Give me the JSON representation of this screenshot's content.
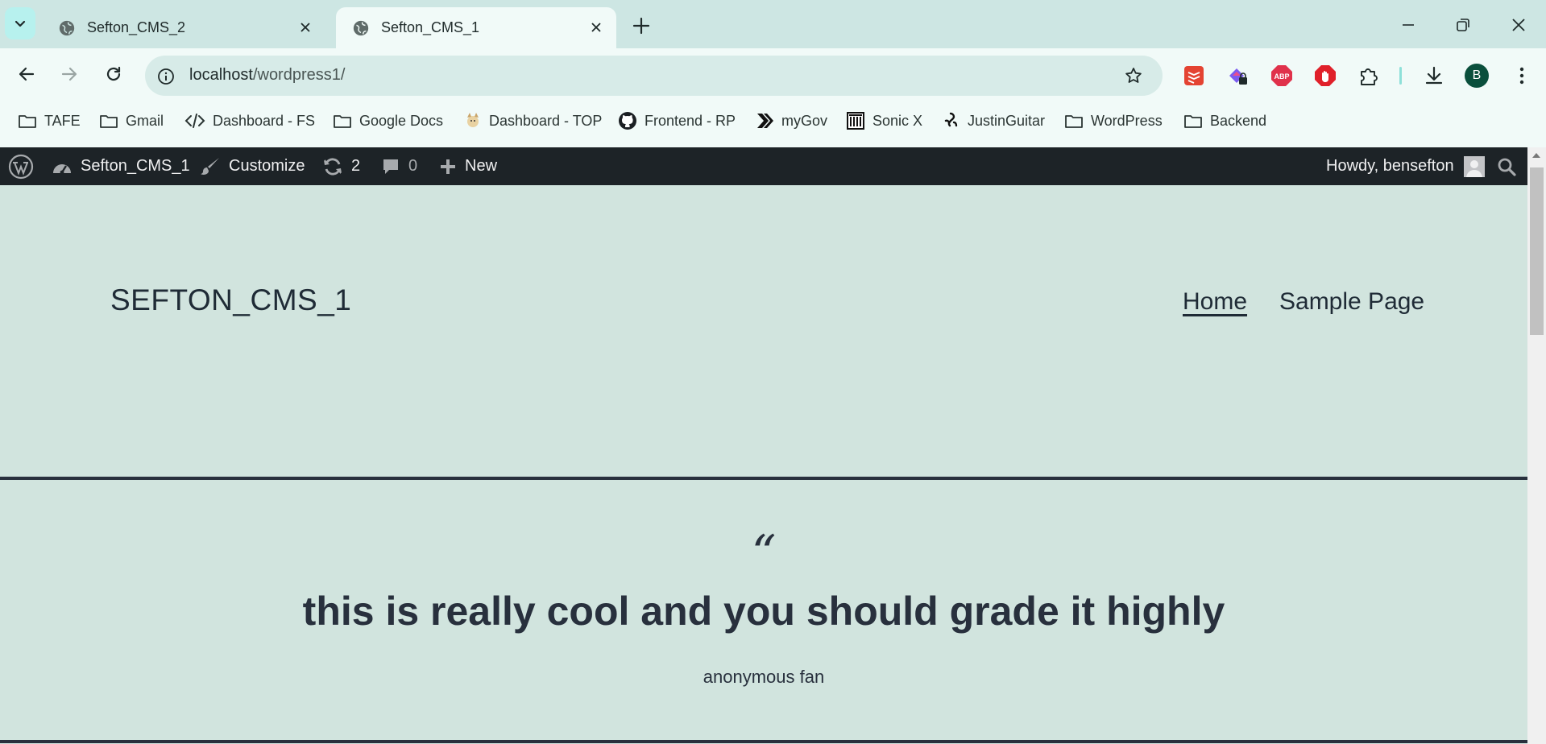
{
  "browser": {
    "tabs": [
      {
        "title": "Sefton_CMS_2",
        "active": false
      },
      {
        "title": "Sefton_CMS_1",
        "active": true
      }
    ],
    "url_host": "localhost",
    "url_path": "/wordpress1/",
    "profile_initial": "B",
    "bookmarks": [
      {
        "label": "TAFE",
        "icon": "folder-icon"
      },
      {
        "label": "Gmail",
        "icon": "folder-icon"
      },
      {
        "label": "Dashboard - FS",
        "icon": "code-icon"
      },
      {
        "label": "Google Docs",
        "icon": "folder-icon"
      },
      {
        "label": "Dashboard - TOP",
        "icon": "odin-icon"
      },
      {
        "label": "Frontend - RP",
        "icon": "github-icon"
      },
      {
        "label": "myGov",
        "icon": "mygov-icon"
      },
      {
        "label": "Sonic X",
        "icon": "building-icon"
      },
      {
        "label": "JustinGuitar",
        "icon": "justinguitar-icon"
      },
      {
        "label": "WordPress",
        "icon": "folder-icon"
      },
      {
        "label": "Backend",
        "icon": "folder-icon"
      }
    ]
  },
  "adminbar": {
    "site_name": "Sefton_CMS_1",
    "customize": "Customize",
    "updates_count": "2",
    "comments_count": "0",
    "new_label": "New",
    "howdy": "Howdy, bensefton"
  },
  "site": {
    "title": "SEFTON_CMS_1",
    "menu": [
      "Home",
      "Sample Page"
    ]
  },
  "quote": {
    "mark": "“",
    "text": "this is really cool and you should grade it highly",
    "cite": "anonymous fan"
  },
  "colors": {
    "page_bg": "#d1e4de",
    "text": "#28303d",
    "adminbar_bg": "#1d2327"
  }
}
